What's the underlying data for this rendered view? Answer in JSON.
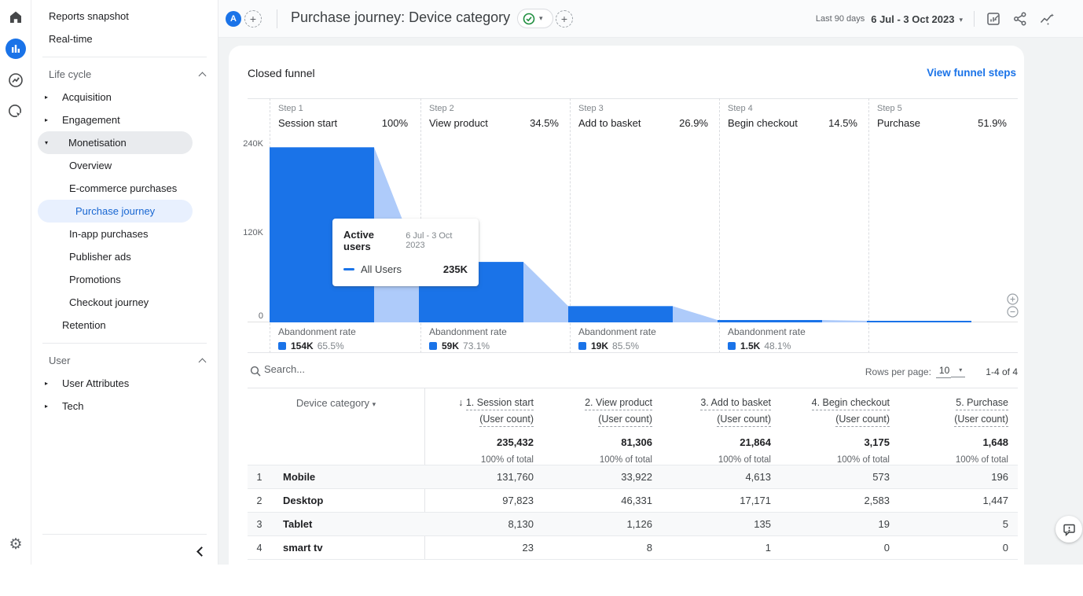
{
  "colors": {
    "primary": "#1a73e8",
    "funnel_bar": "#1a73e8",
    "funnel_transition": "#aecbfa",
    "selected_bg": "#e8f0fe",
    "link": "#1a73e8"
  },
  "sidebar": {
    "items": [
      {
        "label": "Reports snapshot"
      },
      {
        "label": "Real-time"
      },
      {
        "label": "Life cycle"
      },
      {
        "label": "Acquisition"
      },
      {
        "label": "Engagement"
      },
      {
        "label": "Monetisation"
      },
      {
        "label": "Overview"
      },
      {
        "label": "E-commerce purchases"
      },
      {
        "label": "Purchase journey"
      },
      {
        "label": "In-app purchases"
      },
      {
        "label": "Publisher ads"
      },
      {
        "label": "Promotions"
      },
      {
        "label": "Checkout journey"
      },
      {
        "label": "Retention"
      },
      {
        "label": "User"
      },
      {
        "label": "User Attributes"
      },
      {
        "label": "Tech"
      }
    ]
  },
  "topbar": {
    "property_letter": "A",
    "title": "Purchase journey: Device category",
    "date_preset": "Last 90 days",
    "date_range": "6 Jul - 3 Oct 2023"
  },
  "funnel": {
    "title": "Closed funnel",
    "link": "View funnel steps",
    "y_max": 240000,
    "y_ticks": [
      "240K",
      "120K",
      "0"
    ],
    "abandonment_label": "Abandonment rate",
    "steps": [
      {
        "step": "Step 1",
        "name": "Session start",
        "rate": "100%",
        "value": 235432,
        "abandon_count": "154K",
        "abandon_rate": "65.5%"
      },
      {
        "step": "Step 2",
        "name": "View product",
        "rate": "34.5%",
        "value": 81306,
        "abandon_count": "59K",
        "abandon_rate": "73.1%"
      },
      {
        "step": "Step 3",
        "name": "Add to basket",
        "rate": "26.9%",
        "value": 21864,
        "abandon_count": "19K",
        "abandon_rate": "85.5%"
      },
      {
        "step": "Step 4",
        "name": "Begin checkout",
        "rate": "14.5%",
        "value": 3175,
        "abandon_count": "1.5K",
        "abandon_rate": "48.1%"
      },
      {
        "step": "Step 5",
        "name": "Purchase",
        "rate": "51.9%",
        "value": 1648
      }
    ]
  },
  "tooltip": {
    "title": "Active users",
    "date_range": "6 Jul - 3 Oct 2023",
    "series": "All Users",
    "value": "235K"
  },
  "table": {
    "search_placeholder": "Search...",
    "rows_per_page_label": "Rows per page:",
    "rows_per_page": "10",
    "pagination": "1-4 of 4",
    "dimension_header": "Device category",
    "columns": [
      {
        "sort": "↓ ",
        "title": "1. Session start",
        "sub": "(User count)",
        "total": "235,432",
        "total_pct": "100% of total"
      },
      {
        "title": "2. View product",
        "sub": "(User count)",
        "total": "81,306",
        "total_pct": "100% of total"
      },
      {
        "title": "3. Add to basket",
        "sub": "(User count)",
        "total": "21,864",
        "total_pct": "100% of total"
      },
      {
        "title": "4. Begin checkout",
        "sub": "(User count)",
        "total": "3,175",
        "total_pct": "100% of total"
      },
      {
        "title": "5. Purchase",
        "sub": "(User count)",
        "total": "1,648",
        "total_pct": "100% of total"
      }
    ],
    "rows": [
      {
        "num": "1",
        "name": "Mobile",
        "values": [
          "131,760",
          "33,922",
          "4,613",
          "573",
          "196"
        ]
      },
      {
        "num": "2",
        "name": "Desktop",
        "values": [
          "97,823",
          "46,331",
          "17,171",
          "2,583",
          "1,447"
        ]
      },
      {
        "num": "3",
        "name": "Tablet",
        "values": [
          "8,130",
          "1,126",
          "135",
          "19",
          "5"
        ]
      },
      {
        "num": "4",
        "name": "smart tv",
        "values": [
          "23",
          "8",
          "1",
          "0",
          "0"
        ]
      }
    ]
  },
  "chart_data": {
    "type": "bar",
    "subtype": "closed-funnel",
    "title": "Closed funnel",
    "categories": [
      "Session start",
      "View product",
      "Add to basket",
      "Begin checkout",
      "Purchase"
    ],
    "values": [
      235432,
      81306,
      21864,
      3175,
      1648
    ],
    "completion_rates": [
      "100%",
      "34.5%",
      "26.9%",
      "14.5%",
      "51.9%"
    ],
    "abandonment": [
      {
        "count": "154K",
        "rate": "65.5%"
      },
      {
        "count": "59K",
        "rate": "73.1%"
      },
      {
        "count": "19K",
        "rate": "85.5%"
      },
      {
        "count": "1.5K",
        "rate": "48.1%"
      }
    ],
    "ylabel": "Active users",
    "ylim": [
      0,
      240000
    ],
    "y_ticks": [
      "0",
      "120K",
      "240K"
    ],
    "grid": false,
    "legend": [
      "All Users"
    ]
  }
}
